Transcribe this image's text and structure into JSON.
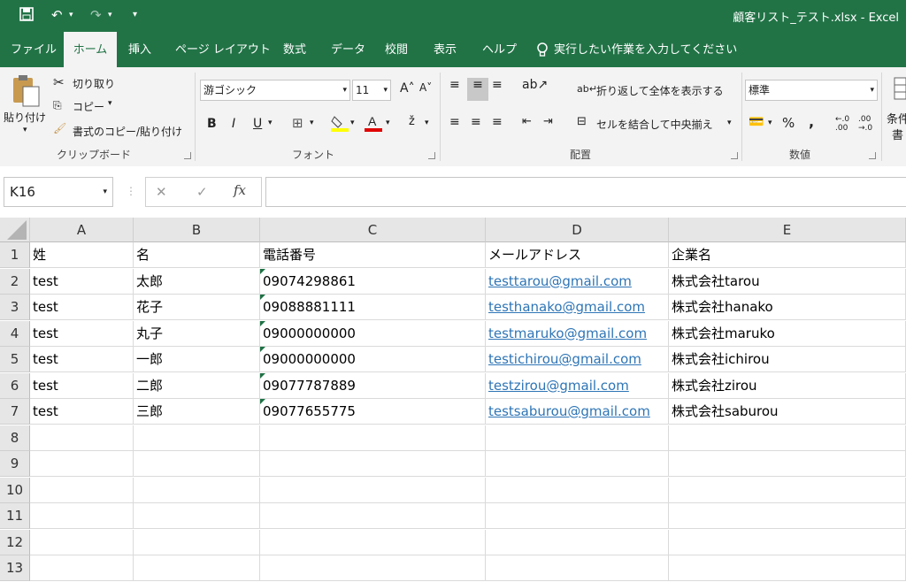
{
  "titlebar": {
    "title": "顧客リスト_テスト.xlsx  -  Excel",
    "save_icon": "save-icon",
    "undo_icon": "undo-icon",
    "redo_icon": "redo-icon"
  },
  "tabs": [
    "ファイル",
    "ホーム",
    "挿入",
    "ページ レイアウト",
    "数式",
    "データ",
    "校閲",
    "表示",
    "ヘルプ"
  ],
  "tell_me": "実行したい作業を入力してください",
  "ribbon": {
    "clipboard": {
      "paste": "貼り付け",
      "cut": "切り取り",
      "copy": "コピー",
      "format_painter": "書式のコピー/貼り付け",
      "label": "クリップボード"
    },
    "font": {
      "name": "游ゴシック",
      "size": "11",
      "bold": "B",
      "italic": "I",
      "underline": "U",
      "label": "フォント"
    },
    "alignment": {
      "wrap": "折り返して全体を表示する",
      "merge": "セルを結合して中央揃え",
      "label": "配置"
    },
    "number": {
      "format": "標準",
      "percent": "%",
      "comma": ",",
      "label": "数値"
    },
    "styles": {
      "cond": "条件",
      "cond2": "書"
    }
  },
  "formula_bar": {
    "name_box": "K16",
    "cancel": "✕",
    "enter": "✓",
    "fx": "fx",
    "value": ""
  },
  "columns": [
    "A",
    "B",
    "C",
    "D",
    "E"
  ],
  "rows": [
    "1",
    "2",
    "3",
    "4",
    "5",
    "6",
    "7",
    "8",
    "9",
    "10",
    "11",
    "12",
    "13"
  ],
  "cells": [
    [
      "姓",
      "名",
      "電話番号",
      "メールアドレス",
      "企業名"
    ],
    [
      "test",
      "太郎",
      "09074298861",
      "testtarou@gmail.com",
      "株式会社tarou"
    ],
    [
      "test",
      "花子",
      "09088881111",
      "testhanako@gmail.com",
      "株式会社hanako"
    ],
    [
      "test",
      "丸子",
      "09000000000",
      "testmaruko@gmail.com",
      "株式会社maruko"
    ],
    [
      "test",
      "一郎",
      "09000000000",
      "testichirou@gmail.com",
      "株式会社ichirou"
    ],
    [
      "test",
      "二郎",
      "09077787889",
      "testzirou@gmail.com",
      "株式会社zirou"
    ],
    [
      "test",
      "三郎",
      "09077655775",
      "testsaburou@gmail.com",
      "株式会社saburou"
    ]
  ],
  "colors": {
    "excel_green": "#217346",
    "link": "#2e75b6"
  }
}
